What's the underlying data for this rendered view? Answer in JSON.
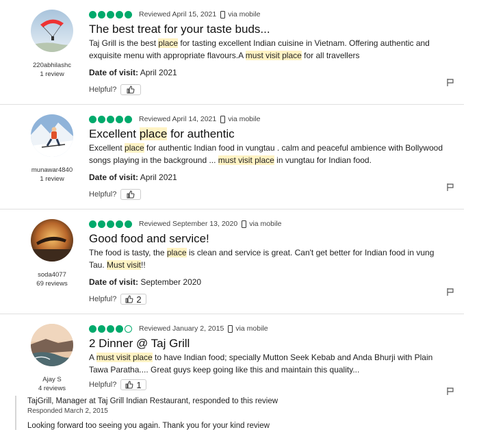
{
  "helpful_label": "Helpful?",
  "date_label": "Date of visit:",
  "reviews": [
    {
      "user": "220abhilashc",
      "user_reviews": "1 review",
      "rating": 5,
      "reviewed": "Reviewed April 15, 2021",
      "via": "via mobile",
      "title": "The best treat for your taste buds...",
      "body_parts": [
        "Taj Grill is the best ",
        "place",
        " for tasting excellent Indian cuisine in Vietnam. Offering authentic and exquisite menu with appropriate flavours.A ",
        "must visit place",
        " for all travellers"
      ],
      "date_of_visit": "April 2021",
      "helpful_count": ""
    },
    {
      "user": "munawar4840",
      "user_reviews": "1 review",
      "rating": 5,
      "reviewed": "Reviewed April 14, 2021",
      "via": "via mobile",
      "title_parts": [
        "Excellent ",
        "place",
        " for authentic"
      ],
      "body_parts": [
        "Excellent ",
        "place",
        " for authentic Indian food in vungtau . calm and peaceful ambience with Bollywood songs playing in the background ... ",
        "must visit place",
        " in vungtau for Indian food."
      ],
      "date_of_visit": "April 2021",
      "helpful_count": ""
    },
    {
      "user": "soda4077",
      "user_reviews": "69 reviews",
      "rating": 5,
      "reviewed": "Reviewed September 13, 2020",
      "via": "via mobile",
      "title": "Good food and service!",
      "body_parts": [
        "The food is tasty, the ",
        "place",
        " is clean and service is great. Can't get better for Indian food in vung Tau. ",
        "Must visit",
        "!!"
      ],
      "date_of_visit": "September 2020",
      "helpful_count": "2"
    },
    {
      "user": "Ajay S",
      "user_reviews": "4 reviews",
      "rating": 4,
      "reviewed": "Reviewed January 2, 2015",
      "via": "via mobile",
      "title": "2 Dinner @ Taj Grill",
      "body_parts": [
        "A ",
        "must visit place",
        " to have Indian food; specially Mutton Seek Kebab and Anda Bhurji with Plain Tawa Paratha.... Great guys keep going like this and maintain this quality..."
      ],
      "helpful_count": "1",
      "response": {
        "title": "TajGrill, Manager at Taj Grill Indian Restaurant, responded to this review",
        "date": "Responded March 2, 2015",
        "text": "Looking forward too seeing you again. Thank you for your kind review"
      }
    }
  ]
}
